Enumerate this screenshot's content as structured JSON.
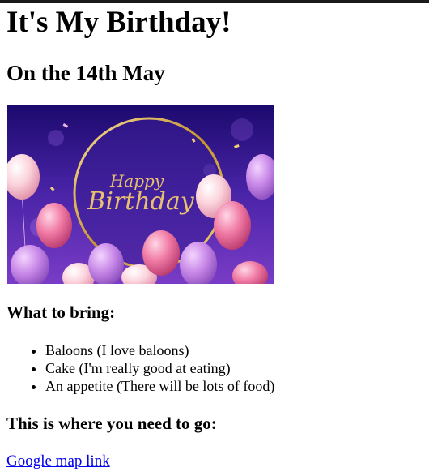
{
  "title": "It's My Birthday!",
  "date_heading": "On the 14th May",
  "banner": {
    "text_line1": "Happy",
    "text_line2": "Birthday",
    "background_color": "#3a1a8a",
    "ring_color": "#d4a548",
    "lettering_color": "#e8c070"
  },
  "bring": {
    "heading": "What to bring:",
    "items": [
      "Baloons (I love baloons)",
      "Cake (I'm really good at eating)",
      "An appetite (There will be lots of food)"
    ]
  },
  "location": {
    "heading": "This is where you need to go:",
    "link_text": "Google map link",
    "link_color": "#0000ee"
  }
}
